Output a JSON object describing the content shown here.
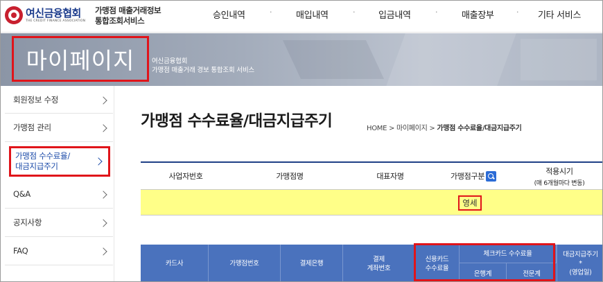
{
  "header": {
    "logo_text": "여신금융협회",
    "logo_sub": "THE CREDIT FINANCE ASSOCIATION",
    "site_title_line1": "가맹점 매출거래정보",
    "site_title_line2": "통합조회서비스",
    "nav": [
      "승인내역",
      "매입내역",
      "입금내역",
      "매출장부",
      "기타 서비스"
    ]
  },
  "banner": {
    "title": "마이페이지",
    "sub_line1": "여신금융협회",
    "sub_line2": "가맹점 매출거래 경보 통합조회 서비스"
  },
  "sidebar": {
    "items": [
      {
        "label": "회원정보 수정"
      },
      {
        "label": "가맹점 관리"
      },
      {
        "label_line1": "가맹점 수수료율/",
        "label_line2": "대금지급주기"
      },
      {
        "label": "Q&A"
      },
      {
        "label": "공지사항"
      },
      {
        "label": "FAQ"
      }
    ]
  },
  "content": {
    "page_title": "가맹점 수수료율/대금지급주기",
    "breadcrumb": {
      "home": "HOME",
      "sep": " > ",
      "mypage": "마이페이지",
      "current": "가맹점 수수료율/대금지급주기"
    },
    "info_table": {
      "headers": [
        "사업자번호",
        "가맹점명",
        "대표자명",
        "가맹점구분"
      ],
      "apply_period": "적용시기",
      "apply_period_note": "(매 6개월마다 변동)",
      "merchant_type_value": "영세"
    },
    "fee_table": {
      "headers": [
        "카드사",
        "가맹점번호",
        "결제은행"
      ],
      "settle_account_line1": "결제",
      "settle_account_line2": "계좌번호",
      "credit_fee_line1": "신용카드",
      "credit_fee_line2": "수수료율",
      "check_fee": "체크카드 수수료율",
      "check_bank": "은행계",
      "check_specialized": "전문계",
      "payment_cycle_line1": "대금지급주기",
      "payment_cycle_line2": "*",
      "payment_cycle_line3": "(영업일)"
    }
  },
  "colors": {
    "highlight": "#e0141a",
    "table_header_blue": "#4a72bd",
    "row_yellow": "#ffff88",
    "accent_blue": "#1e3f86"
  }
}
